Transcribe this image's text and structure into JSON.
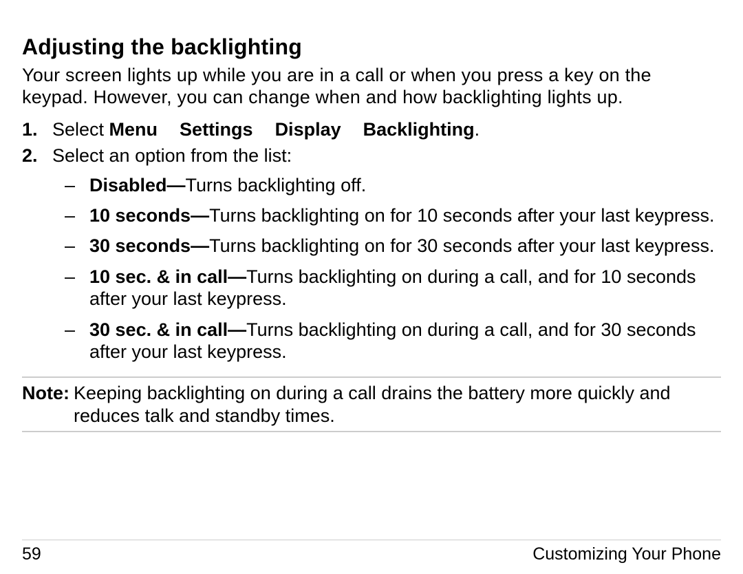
{
  "heading": "Adjusting the backlighting",
  "intro": "Your screen lights up while you are in a call or when you press a key on the keypad. However, you can change when and how backlighting lights up.",
  "step1": {
    "num": "1.",
    "prefix": "Select ",
    "nav1": "Menu",
    "nav2": "Settings",
    "nav3": "Display",
    "nav4": "Backlighting",
    "suffix": "."
  },
  "step2": {
    "num": "2.",
    "text": "Select an option from the list:"
  },
  "options": [
    {
      "label": "Disabled—",
      "desc": "Turns backlighting off."
    },
    {
      "label": "10 seconds—",
      "desc": "Turns backlighting on for 10 seconds after your last keypress."
    },
    {
      "label": "30 seconds—",
      "desc": "Turns backlighting on for 30 seconds after your last keypress."
    },
    {
      "label": "10 sec. & in call—",
      "desc": "Turns backlighting on during a call, and for 10 seconds after your last keypress."
    },
    {
      "label": "30 sec. & in call—",
      "desc": "Turns backlighting on during a call, and for 30 seconds after your last keypress."
    }
  ],
  "dash": "–",
  "note": {
    "label": "Note:",
    "text": "Keeping backlighting on during a call drains the battery more quickly and reduces talk and standby times."
  },
  "footer": {
    "page": "59",
    "section": "Customizing Your Phone"
  }
}
